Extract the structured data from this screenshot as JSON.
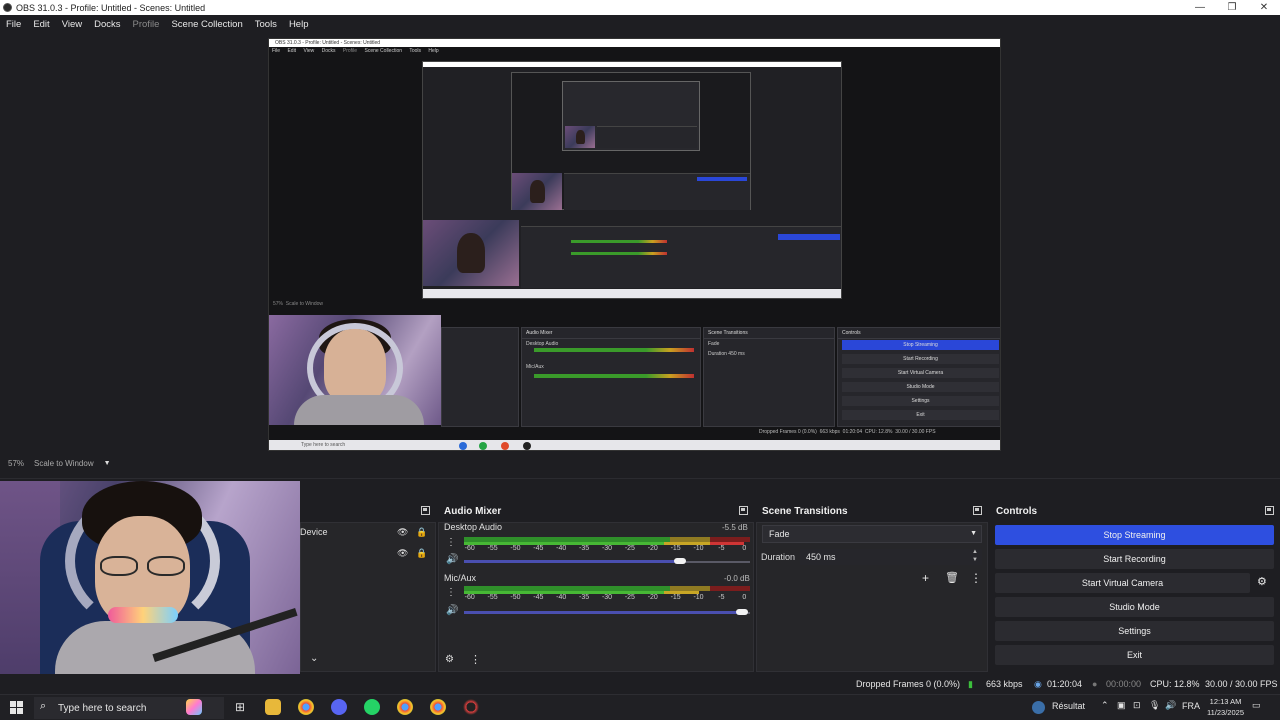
{
  "window": {
    "title": "OBS 31.0.3 - Profile: Untitled - Scenes: Untitled",
    "controls": [
      "—",
      "❐",
      "✕"
    ]
  },
  "menu": {
    "items": [
      {
        "label": "File",
        "enabled": true
      },
      {
        "label": "Edit",
        "enabled": true
      },
      {
        "label": "View",
        "enabled": true
      },
      {
        "label": "Docks",
        "enabled": true
      },
      {
        "label": "Profile",
        "enabled": false
      },
      {
        "label": "Scene Collection",
        "enabled": true
      },
      {
        "label": "Tools",
        "enabled": true
      },
      {
        "label": "Help",
        "enabled": true
      }
    ]
  },
  "preview": {
    "zoom": "57%",
    "scale_mode": "Scale to Window"
  },
  "sources": {
    "items": [
      {
        "label": "Device"
      },
      {
        "label": ""
      }
    ]
  },
  "audio_mixer": {
    "title": "Audio Mixer",
    "channels": [
      {
        "name": "Desktop Audio",
        "level": "-5.5 dB",
        "fill": 0.98,
        "volume": 0.8
      },
      {
        "name": "Mic/Aux",
        "level": "-0.0 dB",
        "fill": 0.88,
        "volume": 1.0
      }
    ],
    "ticks": [
      "-60",
      "-55",
      "-50",
      "-45",
      "-40",
      "-35",
      "-30",
      "-25",
      "-20",
      "-15",
      "-10",
      "-5",
      "0"
    ]
  },
  "scene_transitions": {
    "title": "Scene Transitions",
    "transition": "Fade",
    "duration_label": "Duration",
    "duration_value": "450 ms"
  },
  "controls": {
    "title": "Controls",
    "buttons": {
      "stop_streaming": "Stop Streaming",
      "start_recording": "Start Recording",
      "start_virtual_camera": "Start Virtual Camera",
      "studio_mode": "Studio Mode",
      "settings": "Settings",
      "exit": "Exit"
    }
  },
  "status": {
    "dropped_frames": "Dropped Frames 0 (0.0%)",
    "bitrate": "663 kbps",
    "stream_time": "01:20:04",
    "record_time": "00:00:00",
    "cpu": "CPU: 12.8%",
    "fps": "30.00 / 30.00 FPS"
  },
  "taskbar": {
    "search_placeholder": "Type here to search",
    "result_label": "Résultat",
    "language": "FRA",
    "time": "12:13 AM",
    "date": "11/23/2025"
  },
  "nested_preview": {
    "title": "OBS 31.0.3 - Profile: Untitled - Scenes: Untitled",
    "menu": [
      "File",
      "Edit",
      "View",
      "Docks",
      "Profile",
      "Scene Collection",
      "Tools",
      "Help"
    ],
    "zoom": "57%",
    "scale_mode": "Scale to Window",
    "audio_mixer": "Audio Mixer",
    "desktop_audio": "Desktop Audio",
    "mic_aux": "Mic/Aux",
    "scene_transitions": "Scene Transitions",
    "fade": "Fade",
    "duration": "Duration",
    "duration_value": "450 ms",
    "controls": "Controls",
    "stop_streaming": "Stop Streaming",
    "start_recording": "Start Recording",
    "start_virtual_camera": "Start Virtual Camera",
    "studio_mode": "Studio Mode",
    "settings": "Settings",
    "exit": "Exit",
    "dropped": "Dropped Frames 0 (0.0%)",
    "bitrate": "663 kbps",
    "time": "01:20:04",
    "cpu": "CPU: 12.8%",
    "fps": "30.00 / 30.00 FPS",
    "search": "Type here to search"
  },
  "colors": {
    "accent_blue": "#2e4fe0",
    "meter_green": "#2f8f2a",
    "meter_yellow": "#8f7a22",
    "meter_red": "#7a1d1d",
    "background": "#1e1e22"
  }
}
